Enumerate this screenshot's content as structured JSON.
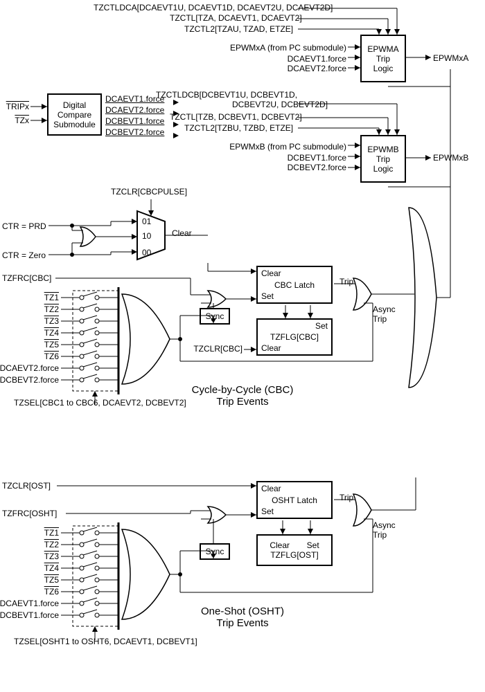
{
  "top": {
    "tzctldca": "TZCTLDCA[DCAEVT1U, DCAEVT1D, DCAEVT2U, DCAEVT2D]",
    "tzctl_a": "TZCTL[TZA, DCAEVT1, DCAEVT2]",
    "tzctl2_a": "TZCTL2[TZAU, TZAD, ETZE]",
    "epwmxa_in": "EPWMxA (from PC submodule)",
    "dcaevt1f": "DCAEVT1.force",
    "dcaevt2f": "DCAEVT2.force",
    "epwma_box": "EPWMA Trip Logic",
    "epwmxa_out": "EPWMxA",
    "tzctldcb": "TZCTLDCB[DCBEVT1U, DCBEVT1D, DCBEVT2U, DCBEVT2D]",
    "tzctl_b": "TZCTL[TZB, DCBEVT1, DCBEVT2]",
    "tzctl2_b": "TZCTL2[TZBU, TZBD, ETZE]",
    "epwmxb_in": "EPWMxB (from PC submodule)",
    "dcbevt1f": "DCBEVT1.force",
    "dcbevt2f": "DCBEVT2.force",
    "epwmb_box": "EPWMB Trip Logic",
    "epwmxb_out": "EPWMxB"
  },
  "dc": {
    "tripx": "TRIPx",
    "tzx": "TZx",
    "box": "Digital Compare Submodule",
    "out1": "DCAEVT1.force",
    "out2": "DCAEVT2.force",
    "out3": "DCBEVT1.force",
    "out4": "DCBEVT2.force"
  },
  "mux": {
    "tzclr_cbcpulse": "TZCLR[CBCPULSE]",
    "ctr_prd": "CTR = PRD",
    "ctr_zero": "CTR = Zero",
    "m01": "01",
    "m10": "10",
    "m00": "00",
    "clear_out": "Clear"
  },
  "cbc": {
    "tzfrc": "TZFRC[CBC]",
    "inputs": [
      "TZ1",
      "TZ2",
      "TZ3",
      "TZ4",
      "TZ5",
      "TZ6",
      "DCAEVT2.force",
      "DCBEVT2.force"
    ],
    "tzsel": "TZSEL[CBC1 to CBC6, DCAEVT2, DCBEVT2]",
    "sync": "Sync",
    "latch": "CBC Latch",
    "latch_clear": "Clear",
    "latch_set": "Set",
    "trip": "Trip",
    "async": "Async Trip",
    "tzflg": "TZFLG[CBC]",
    "tzflg_set": "Set",
    "tzflg_clear": "Clear",
    "tzclr": "TZCLR[CBC]",
    "title": "Cycle-by-Cycle (CBC) Trip Events"
  },
  "osht": {
    "tzclr": "TZCLR[OST]",
    "tzfrc": "TZFRC[OSHT]",
    "inputs": [
      "TZ1",
      "TZ2",
      "TZ3",
      "TZ4",
      "TZ5",
      "TZ6",
      "DCAEVT1.force",
      "DCBEVT1.force"
    ],
    "tzsel": "TZSEL[OSHT1 to OSHT6, DCAEVT1, DCBEVT1]",
    "sync": "Sync",
    "latch": "OSHT Latch",
    "latch_clear": "Clear",
    "latch_set": "Set",
    "trip": "Trip",
    "async": "Async Trip",
    "tzflg": "TZFLG[OST]",
    "tzflg_set": "Set",
    "tzflg_clear": "Clear",
    "title": "One-Shot (OSHT) Trip Events"
  }
}
